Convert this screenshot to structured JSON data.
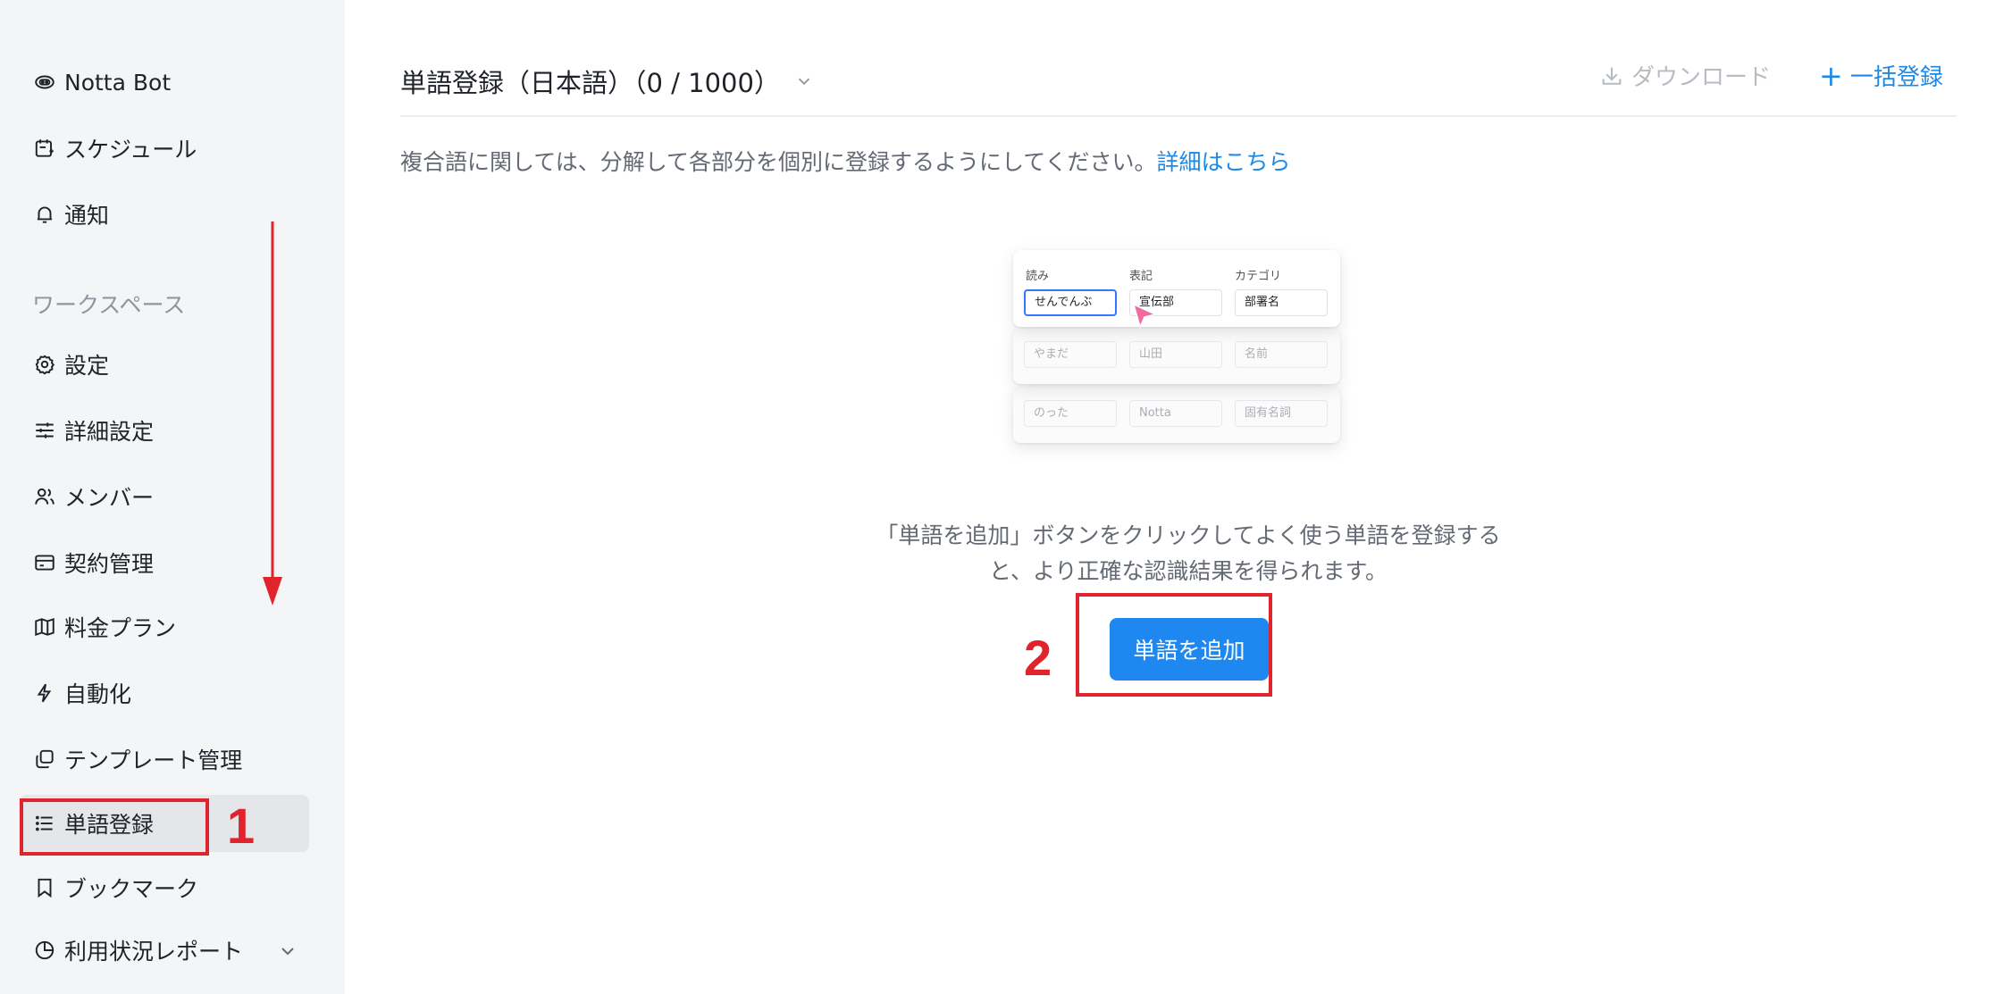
{
  "sidebar": {
    "items": [
      {
        "label": "Notta Bot",
        "icon": "bot-icon"
      },
      {
        "label": "スケジュール",
        "icon": "calendar-icon"
      },
      {
        "label": "通知",
        "icon": "bell-icon"
      },
      {
        "label": "設定",
        "icon": "gear-icon"
      },
      {
        "label": "詳細設定",
        "icon": "sliders-icon"
      },
      {
        "label": "メンバー",
        "icon": "users-icon"
      },
      {
        "label": "契約管理",
        "icon": "card-icon"
      },
      {
        "label": "料金プラン",
        "icon": "map-icon"
      },
      {
        "label": "自動化",
        "icon": "lightning-icon"
      },
      {
        "label": "テンプレート管理",
        "icon": "template-icon"
      },
      {
        "label": "単語登録",
        "icon": "list-icon",
        "active": true
      },
      {
        "label": "ブックマーク",
        "icon": "bookmark-icon"
      },
      {
        "label": "利用状況レポート",
        "icon": "pie-chart-icon"
      }
    ],
    "section_label": "ワークスペース"
  },
  "annotations": {
    "step1": "1",
    "step2": "2",
    "color": "#e0242b"
  },
  "header": {
    "title": "単語登録（日本語）（0 / 1000）",
    "download_label": "ダウンロード",
    "bulk_label": "一括登録"
  },
  "note": {
    "text": "複合語に関しては、分解して各部分を個別に登録するようにしてください。",
    "link": "詳細はこちら"
  },
  "illustration": {
    "columns": [
      "読み",
      "表記",
      "カテゴリ"
    ],
    "rows": [
      [
        "せんでんぶ",
        "宣伝部",
        "部署名"
      ],
      [
        "やまだ",
        "山田",
        "名前"
      ],
      [
        "のった",
        "Notta",
        "固有名詞"
      ]
    ]
  },
  "empty_state": {
    "line1": "「単語を追加」ボタンをクリックしてよく使う単語を登録する",
    "line2": "と、より正確な認識結果を得られます。",
    "button": "単語を追加"
  },
  "colors": {
    "accent": "#1e88f0",
    "link": "#1e88e5",
    "sidebar_bg": "#f4f5f7",
    "active_bg": "#e4e6ea"
  }
}
